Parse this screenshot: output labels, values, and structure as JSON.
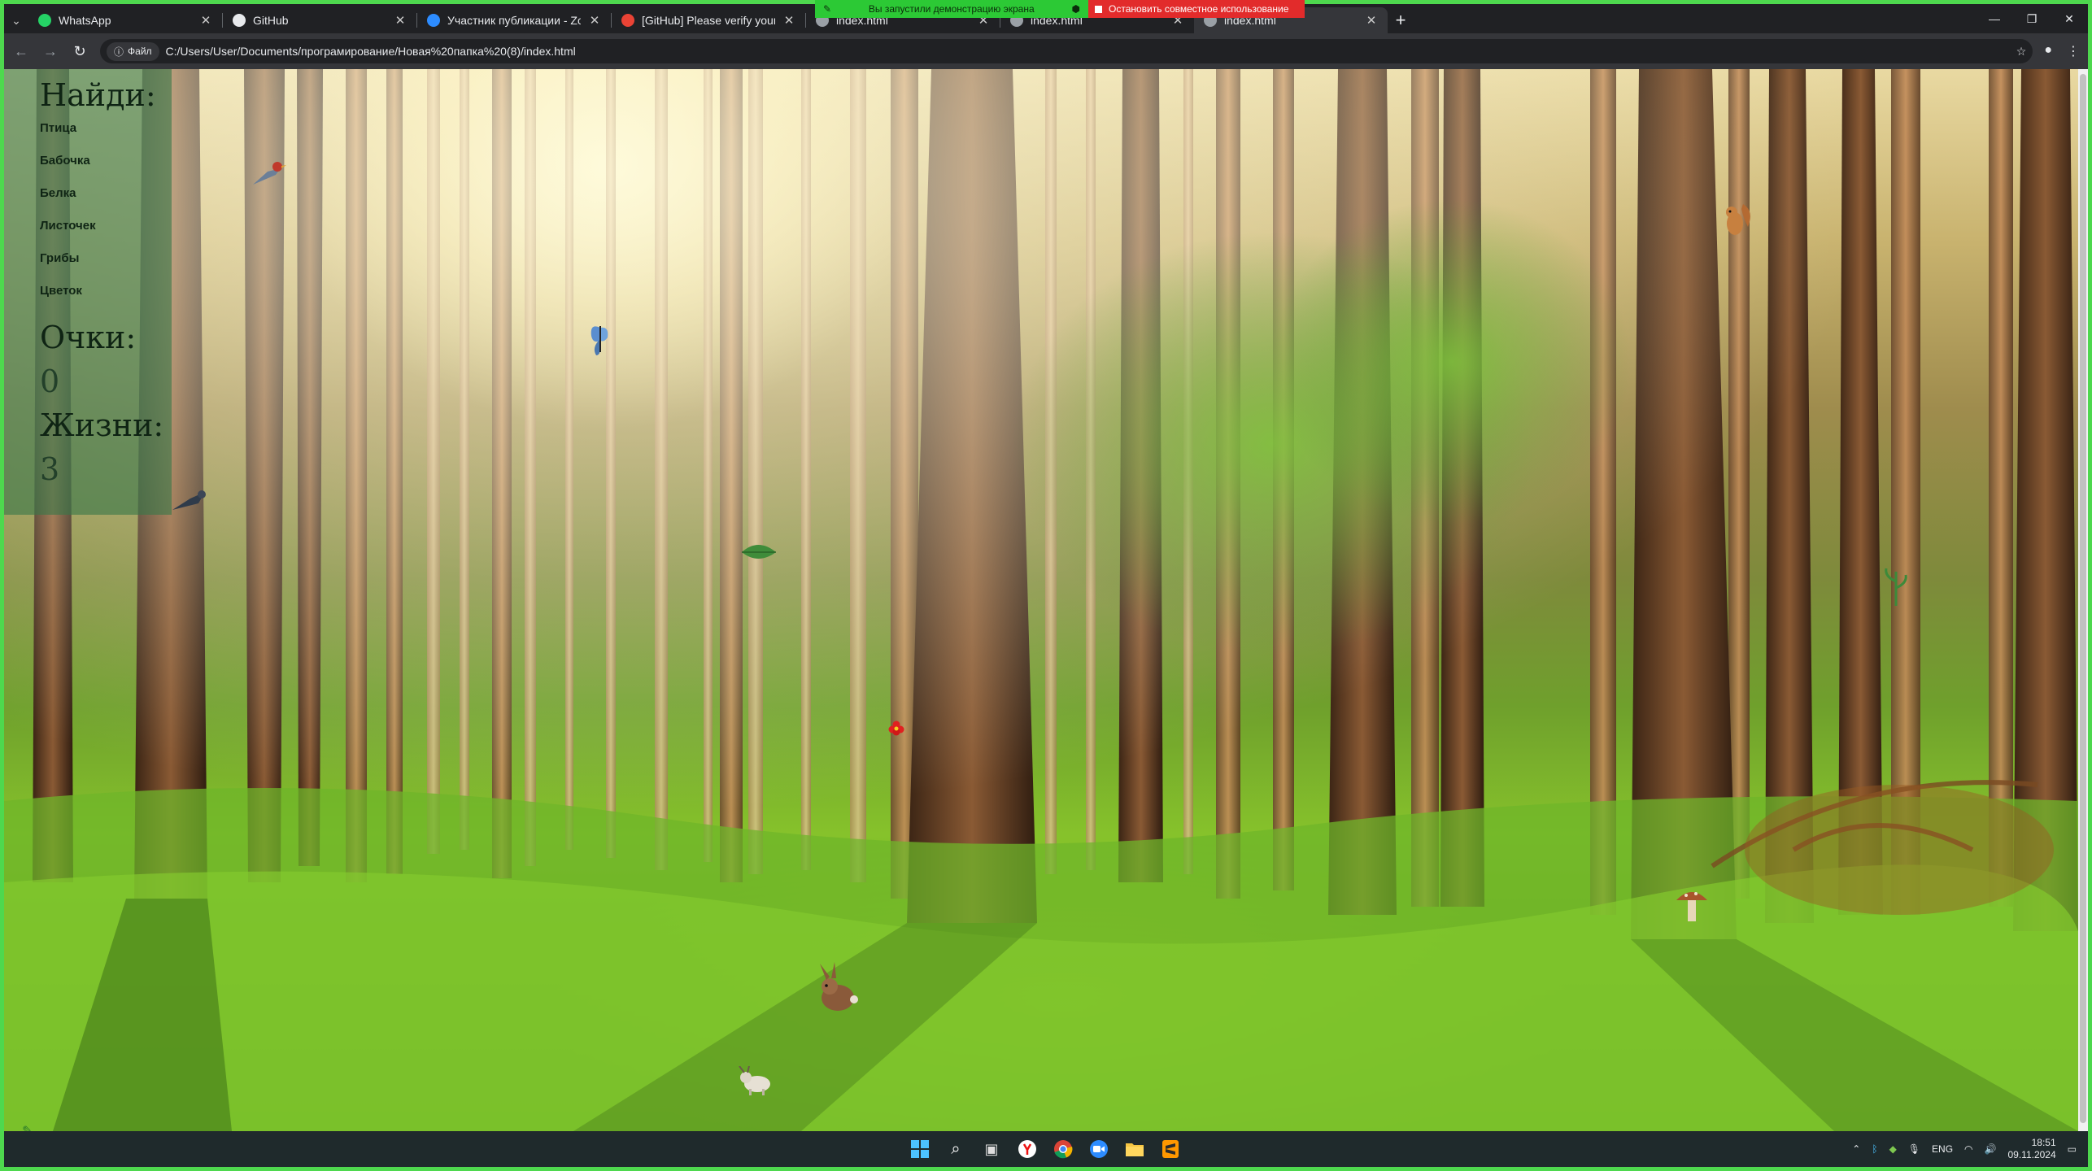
{
  "browser": {
    "tabs": [
      {
        "title": "WhatsApp",
        "favicon": "whatsapp-icon",
        "color": "#25d366",
        "active": false
      },
      {
        "title": "GitHub",
        "favicon": "github-icon",
        "color": "#e8eaed",
        "active": false
      },
      {
        "title": "Участник публикации - Zoom",
        "favicon": "zoom-icon",
        "color": "#2d8cff",
        "active": false
      },
      {
        "title": "[GitHub] Please verify your dev",
        "favicon": "gmail-icon",
        "color": "#ea4335",
        "active": false
      },
      {
        "title": "index.html",
        "favicon": "page-icon",
        "color": "#9aa0a6",
        "active": false
      },
      {
        "title": "index.html",
        "favicon": "page-icon",
        "color": "#9aa0a6",
        "active": false
      },
      {
        "title": "index.html",
        "favicon": "page-icon",
        "color": "#9aa0a6",
        "active": true
      }
    ],
    "share": {
      "notice": "Вы запустили демонстрацию экрана",
      "stop_label": "Остановить совместное использование"
    },
    "address": {
      "chip_label": "Файл",
      "url": "C:/Users/User/Documents/програмирование/Новая%20папка%20(8)/index.html"
    }
  },
  "game": {
    "find_title": "Найди:",
    "targets": [
      "Птица",
      "Бабочка",
      "Белка",
      "Листочек",
      "Грибы",
      "Цветок"
    ],
    "score_title": "Очки:",
    "score": "0",
    "lives_title": "Жизни:",
    "lives": "3"
  },
  "taskbar": {
    "lang": "ENG",
    "time": "18:51",
    "date": "09.11.2024"
  }
}
